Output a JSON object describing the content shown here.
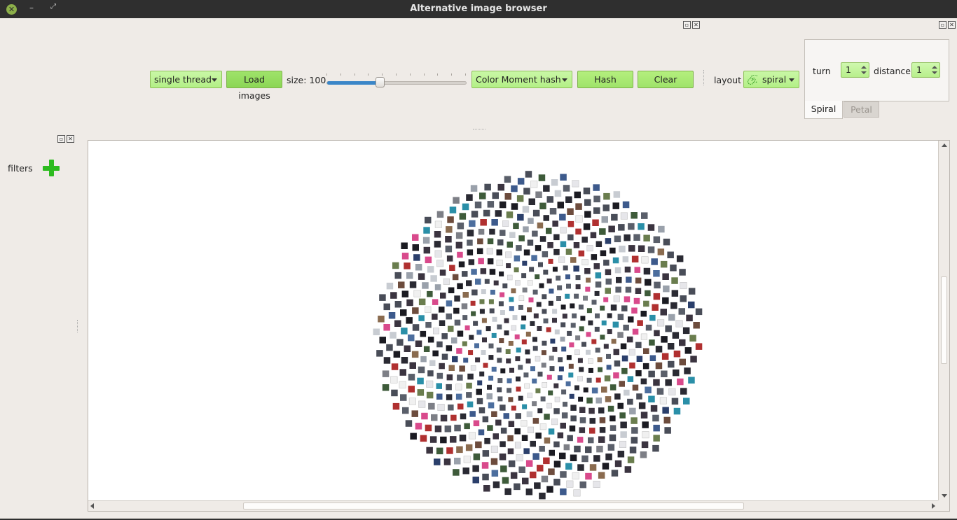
{
  "window": {
    "title": "Alternative image browser"
  },
  "toolbar": {
    "thread_mode": "single thread",
    "load_label": "Load images",
    "size_label": "size: 100",
    "size_value": 100,
    "hash_method": "Color Moment hash",
    "hash_label": "Hash",
    "clear_label": "Clear",
    "layout_label": "layout",
    "layout_value": "spiral"
  },
  "layout_panel": {
    "turn_label": "turn",
    "turn_value": "1",
    "distance_label": "distance",
    "distance_value": "1",
    "tabs": [
      {
        "label": "Spiral",
        "active": true
      },
      {
        "label": "Petal",
        "active": false
      }
    ]
  },
  "filters": {
    "label": "filters"
  },
  "colors": {
    "accent_green": "#b4ef7e",
    "add_icon": "#2dbb1f",
    "slider": "#3a86c8"
  },
  "icons": {
    "close": "close-icon",
    "minimize": "minimize-icon",
    "maximize": "maximize-icon",
    "add": "plus-icon",
    "spiral": "spiral-icon"
  }
}
